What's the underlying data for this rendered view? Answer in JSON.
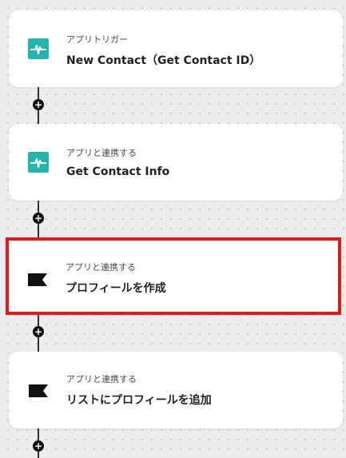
{
  "steps": [
    {
      "category": "アプリトリガー",
      "title": "New Contact（Get Contact ID）",
      "icon": "pulse-app-icon"
    },
    {
      "category": "アプリと連携する",
      "title": "Get Contact Info",
      "icon": "pulse-app-icon"
    },
    {
      "category": "アプリと連携する",
      "title": "プロフィールを作成",
      "icon": "flag-app-icon",
      "selected": true
    },
    {
      "category": "アプリと連携する",
      "title": "リストにプロフィールを追加",
      "icon": "flag-app-icon"
    }
  ],
  "add_node_symbol": "+",
  "colors": {
    "teal": "#26b5ad",
    "selection_border": "#dd1c1c",
    "node": "#111111"
  }
}
